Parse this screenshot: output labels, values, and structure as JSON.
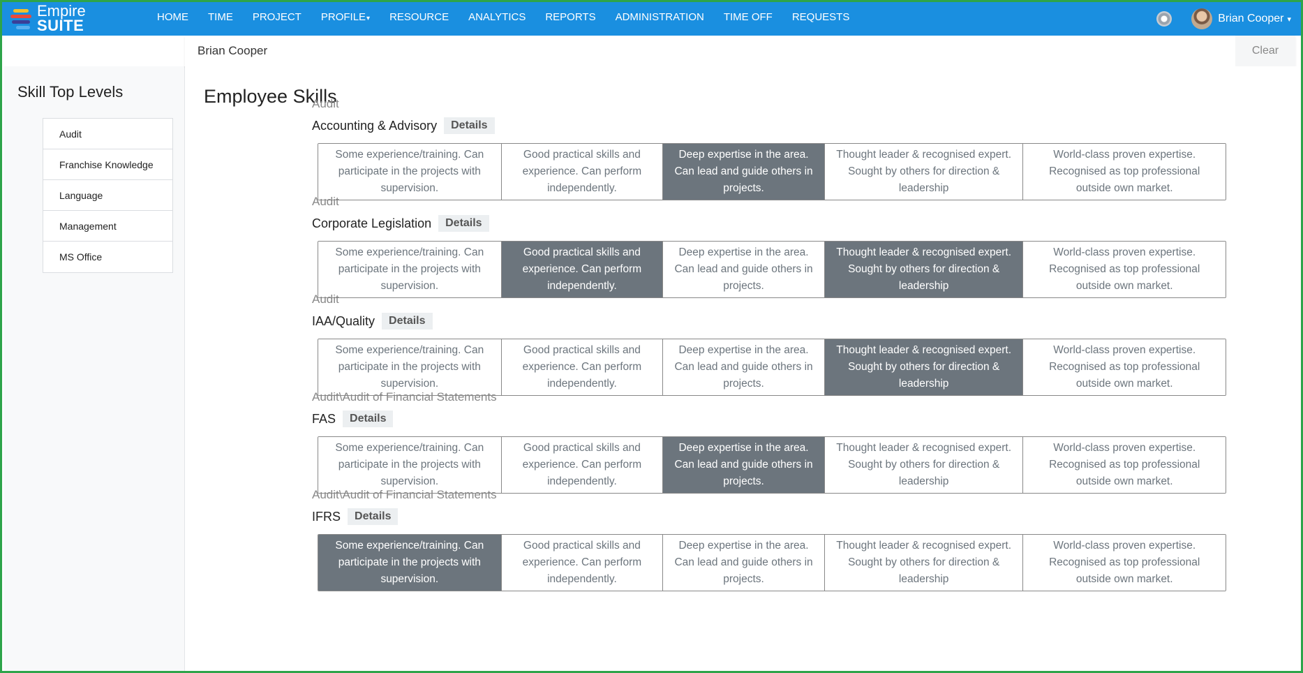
{
  "app": {
    "logo_line1": "Empire",
    "logo_line2": "SUITE",
    "logo_colors": [
      "#f2c12e",
      "#e94b3c",
      "#3a3f98",
      "#1a8fe0"
    ]
  },
  "nav": {
    "items": [
      {
        "label": "HOME",
        "name": "nav-home"
      },
      {
        "label": "TIME",
        "name": "nav-time"
      },
      {
        "label": "PROJECT",
        "name": "nav-project"
      },
      {
        "label": "PROFILE",
        "name": "nav-profile",
        "dropdown": true
      },
      {
        "label": "RESOURCE",
        "name": "nav-resource"
      },
      {
        "label": "ANALYTICS",
        "name": "nav-analytics"
      },
      {
        "label": "REPORTS",
        "name": "nav-reports"
      },
      {
        "label": "ADMINISTRATION",
        "name": "nav-administration"
      },
      {
        "label": "TIME OFF",
        "name": "nav-time-off"
      },
      {
        "label": "REQUESTS",
        "name": "nav-requests"
      }
    ],
    "user_name": "Brian Cooper",
    "caret": "▾"
  },
  "search": {
    "value": "Brian Cooper",
    "clear_label": "Clear"
  },
  "sidebar": {
    "title": "Skill Top Levels",
    "items": [
      "Audit",
      "Franchise Knowledge",
      "Language",
      "Management",
      "MS Office"
    ]
  },
  "main": {
    "title": "Employee Skills",
    "details_label": "Details",
    "levels": [
      "Some experience/training. Can participate in the projects with supervision.",
      "Good practical skills and experience. Can perform independently.",
      "Deep expertise in the area. Can lead and guide others in projects.",
      "Thought leader & recognised expert. Sought by others for direction & leadership",
      "World-class proven expertise. Recognised as top professional outside own market."
    ],
    "skills": [
      {
        "path": "Audit",
        "name": "Accounting & Advisory",
        "selected": [
          3
        ]
      },
      {
        "path": "Audit",
        "name": "Corporate Legislation",
        "selected": [
          2,
          4
        ]
      },
      {
        "path": "Audit",
        "name": "IAA/Quality",
        "selected": [
          4
        ]
      },
      {
        "path": "Audit\\Audit of Financial Statements",
        "name": "FAS",
        "selected": [
          3
        ]
      },
      {
        "path": "Audit\\Audit of Financial Statements",
        "name": "IFRS",
        "selected": [
          1
        ]
      }
    ],
    "selected_color": "#6c757d"
  }
}
